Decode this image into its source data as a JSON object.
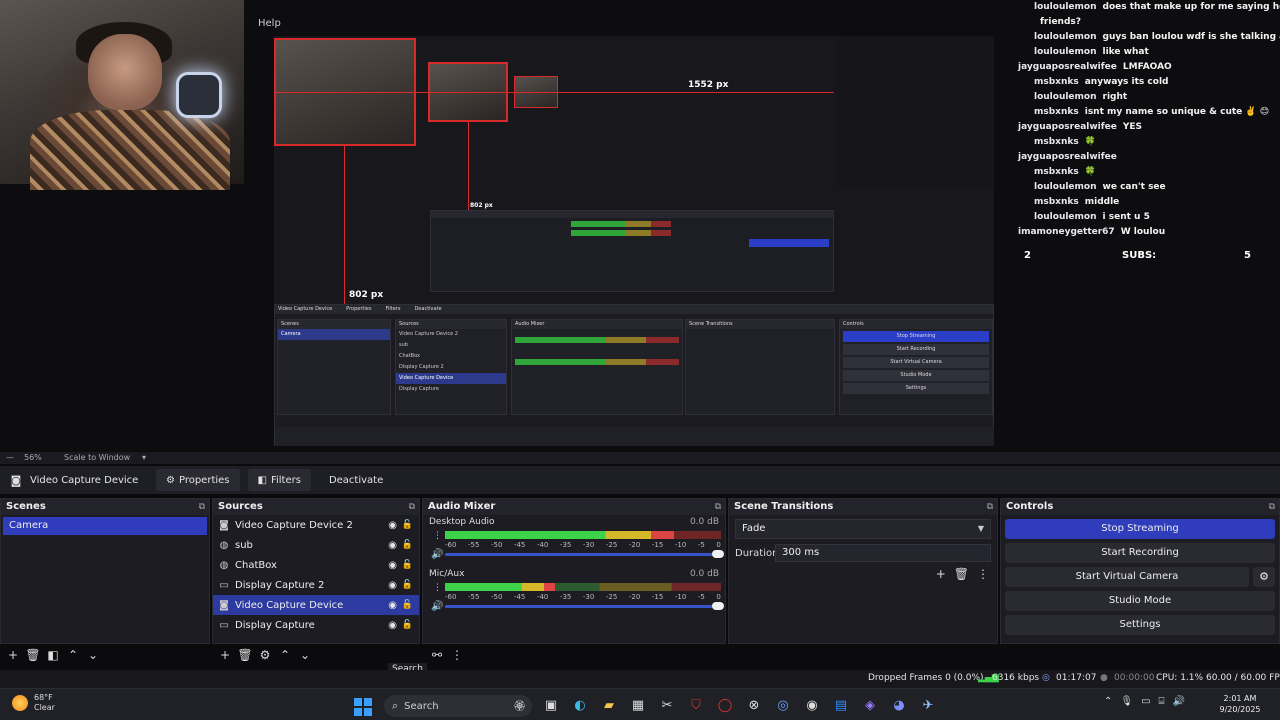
{
  "preview": {
    "help_label": "Help",
    "px_label_top": "1552 px",
    "px_label_mid": "802 px",
    "px_label_left": "802 px",
    "footer_zoom": "56%",
    "footer_scale": "Scale to Window",
    "nested_hdr_scenes": "Scenes",
    "nested_hdr_sources": "Sources",
    "nested_hdr_mixer": "Audio Mixer",
    "nested_hdr_trans": "Scene Transitions",
    "nested_hdr_controls": "Controls",
    "nested_scene": "Camera",
    "nested_sources": [
      "Video Capture Device 2",
      "sub",
      "ChatBox",
      "Display Capture 2",
      "Video Capture Device",
      "Display Capture"
    ],
    "nested_controls": [
      "Stop Streaming",
      "Start Recording",
      "Start Virtual Camera",
      "Studio Mode",
      "Settings"
    ],
    "nested_tabs": [
      "Video Capture Device",
      "Properties",
      "Filters",
      "Deactivate"
    ]
  },
  "chat": {
    "lines": [
      {
        "user": "louloulemon",
        "msg": "does that make up for me saying he doesn't"
      },
      {
        "user": "",
        "msg": "friends?"
      },
      {
        "user": "louloulemon",
        "msg": "guys ban loulou wdf is she talking abt"
      },
      {
        "user": "louloulemon",
        "msg": "like what"
      },
      {
        "user": "jayguaposrealwifee",
        "msg": "LMFAOAO"
      },
      {
        "user": "msbxnks",
        "msg": "anyways its cold"
      },
      {
        "user": "louloulemon",
        "msg": "right"
      },
      {
        "user": "msbxnks",
        "msg": "isnt my name so unique & cute ✌️ 😊"
      },
      {
        "user": "jayguaposrealwifee",
        "msg": "YES"
      },
      {
        "user": "msbxnks",
        "msg": "🍀"
      },
      {
        "user": "jayguaposrealwifee",
        "msg": ""
      },
      {
        "user": "msbxnks",
        "msg": "🍀"
      },
      {
        "user": "louloulemon",
        "msg": "we can't see"
      },
      {
        "user": "msbxnks",
        "msg": "middle"
      },
      {
        "user": "louloulemon",
        "msg": "i sent u 5"
      },
      {
        "user": "imamoneygetter67",
        "msg": "W loulou"
      }
    ],
    "subs_left": "2",
    "subs_label": "SUBS:",
    "subs_right": "5"
  },
  "toolbar": {
    "source_name": "Video Capture Device",
    "properties": "Properties",
    "filters": "Filters",
    "deactivate": "Deactivate"
  },
  "scenes": {
    "title": "Scenes",
    "items": [
      "Camera"
    ]
  },
  "sources": {
    "title": "Sources",
    "items": [
      {
        "name": "Video Capture Device 2",
        "icon": "camera-icon"
      },
      {
        "name": "sub",
        "icon": "browser-icon"
      },
      {
        "name": "ChatBox",
        "icon": "browser-icon"
      },
      {
        "name": "Display Capture 2",
        "icon": "monitor-icon"
      },
      {
        "name": "Video Capture Device",
        "icon": "camera-icon"
      },
      {
        "name": "Display Capture",
        "icon": "monitor-icon"
      }
    ]
  },
  "mixer": {
    "title": "Audio Mixer",
    "channels": [
      {
        "name": "Desktop Audio",
        "db": "0.0 dB",
        "level": 0.83
      },
      {
        "name": "Mic/Aux",
        "db": "0.0 dB",
        "level": 0.4
      }
    ],
    "ticks": [
      "-60",
      "-55",
      "-50",
      "-45",
      "-40",
      "-35",
      "-30",
      "-25",
      "-20",
      "-15",
      "-10",
      "-5",
      "0"
    ]
  },
  "transitions": {
    "title": "Scene Transitions",
    "selected": "Fade",
    "duration_label": "Duration",
    "duration_value": "300 ms"
  },
  "controls": {
    "title": "Controls",
    "stop_streaming": "Stop Streaming",
    "start_recording": "Start Recording",
    "start_virtual_camera": "Start Virtual Camera",
    "studio_mode": "Studio Mode",
    "settings": "Settings"
  },
  "tooltip": "Search",
  "status": {
    "dropped_frames": "Dropped Frames 0 (0.0%)",
    "bitrate": "6316 kbps",
    "stream_time": "01:17:07",
    "record_time": "00:00:00",
    "cpu": "CPU: 1.1%",
    "fps": "60.00 / 60.00 FPS"
  },
  "taskbar": {
    "temp": "68°F",
    "condition": "Clear",
    "search_placeholder": "Search",
    "time": "2:01 AM",
    "date": "9/20/2025"
  },
  "colors": {
    "accent": "#2f3dbd",
    "live_green": "#3cd24a",
    "recording_red": "#d82a2a"
  }
}
